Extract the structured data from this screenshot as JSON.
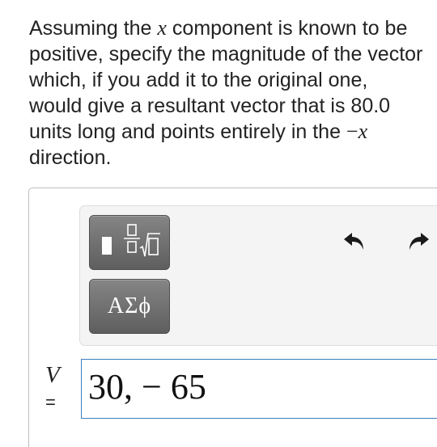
{
  "question": {
    "line1_before": "Assuming the ",
    "var_x": "x",
    "line1_after": " component is known to be positive, specify the magnitude of the vector which, if you add it to the original one, would give a resultant vector that is 80.0 units long and points entirely in the ",
    "neg_sign": "−",
    "var_x2": "x",
    "ending": " direction."
  },
  "toolbar": {
    "templates_icon": "fraction-sqrt-template-icon",
    "symbols_label": "ΑΣϕ",
    "undo_icon": "undo-arrow-icon",
    "redo_icon": "redo-arrow-icon"
  },
  "answer": {
    "variable": "V",
    "equals": "=",
    "value": "30, − 65"
  },
  "colors": {
    "input_border": "#3b7fbf",
    "button_gray": "#6e6e6e",
    "toolbar_bg": "#f4f4f4"
  }
}
